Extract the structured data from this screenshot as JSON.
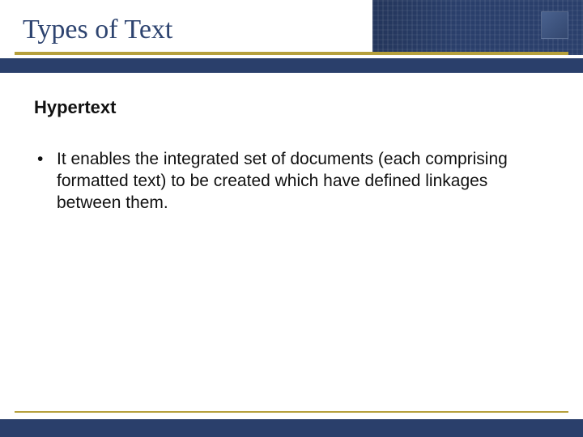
{
  "slide": {
    "title": "Types of Text",
    "subheading": "Hypertext",
    "bullets": [
      "It enables the integrated set of documents (each comprising formatted text) to be created which have defined linkages between them."
    ]
  },
  "theme": {
    "accent_navy": "#2a3f6b",
    "accent_gold": "#b6a03c",
    "title_color": "#2e4470"
  }
}
